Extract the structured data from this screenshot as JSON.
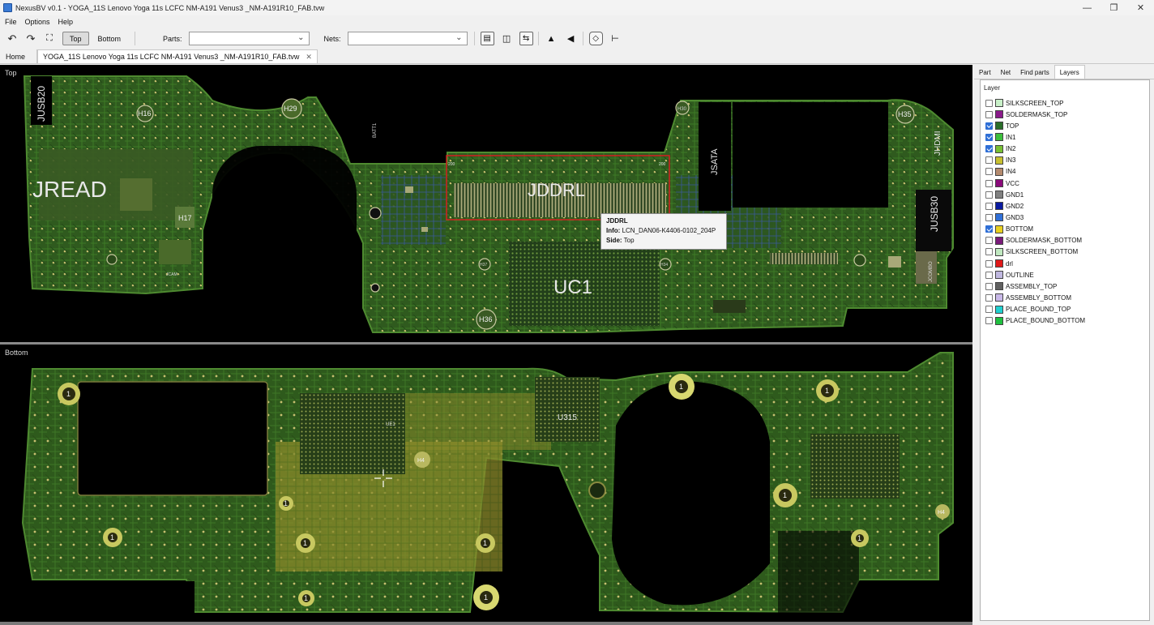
{
  "window": {
    "title": "NexusBV v0.1 - YOGA_11S Lenovo Yoga 11s LCFC NM-A191 Venus3 _NM-A191R10_FAB.tvw"
  },
  "menu": [
    "File",
    "Options",
    "Help"
  ],
  "toolbar": {
    "top_label": "Top",
    "bottom_label": "Bottom",
    "parts_label": "Parts:",
    "parts_value": "",
    "nets_label": "Nets:",
    "nets_value": ""
  },
  "tabs": [
    {
      "label": "Home"
    },
    {
      "label": "YOGA_11S Lenovo Yoga 11s LCFC NM-A191 Venus3 _NM-A191R10_FAB.tvw"
    }
  ],
  "views": {
    "top_label": "Top",
    "bottom_label": "Bottom"
  },
  "board_top_labels": {
    "jread": "JREAD",
    "jddrl": "JDDRL",
    "uc1": "UC1",
    "jusb20": "JUSB20",
    "jsata": "JSATA",
    "jhdmi": "JHDMI",
    "jusb30": "JUSB30",
    "h16": "H16",
    "h29": "H29",
    "h17": "H17",
    "h35": "H35",
    "h36": "H36",
    "h30": "H30",
    "h37": "H37",
    "h34": "H34",
    "batt1": "BATT1",
    "jcombo": "JCOMBO",
    "jcam": "JCAM",
    "ctr1": "200",
    "ctr2": "200"
  },
  "board_bottom_labels": {
    "u315": "U315",
    "ue1": "UE1",
    "h4a": "H4",
    "h4b": "H4",
    "one": "1"
  },
  "tooltip": {
    "title": "JDDRL",
    "info_label": "Info:",
    "info_value": "LCN_DAN06-K4406-0102_204P",
    "side_label": "Side:",
    "side_value": "Top"
  },
  "right_panel": {
    "tabs": [
      "Part",
      "Net",
      "Find parts",
      "Layers"
    ],
    "layer_header": "Layer",
    "layers": [
      {
        "name": "SILKSCREEN_TOP",
        "checked": false,
        "color": "#c8f0c8"
      },
      {
        "name": "SOLDERMASK_TOP",
        "checked": false,
        "color": "#8a1a8a"
      },
      {
        "name": "TOP",
        "checked": true,
        "color": "#2a6e2a"
      },
      {
        "name": "IN1",
        "checked": true,
        "color": "#3cbf3c"
      },
      {
        "name": "IN2",
        "checked": true,
        "color": "#78c034"
      },
      {
        "name": "IN3",
        "checked": false,
        "color": "#c8c030"
      },
      {
        "name": "IN4",
        "checked": false,
        "color": "#b48a6e"
      },
      {
        "name": "VCC",
        "checked": false,
        "color": "#8a0a7a"
      },
      {
        "name": "GND1",
        "checked": false,
        "color": "#808080"
      },
      {
        "name": "GND2",
        "checked": false,
        "color": "#0a1aa0"
      },
      {
        "name": "GND3",
        "checked": false,
        "color": "#3070d8"
      },
      {
        "name": "BOTTOM",
        "checked": true,
        "color": "#e8d020"
      },
      {
        "name": "SOLDERMASK_BOTTOM",
        "checked": false,
        "color": "#7a1a7a"
      },
      {
        "name": "SILKSCREEN_BOTTOM",
        "checked": false,
        "color": "#c0e8c0"
      },
      {
        "name": "drl",
        "checked": false,
        "color": "#e01818"
      },
      {
        "name": "OUTLINE",
        "checked": false,
        "color": "#c0b8e0"
      },
      {
        "name": "ASSEMBLY_TOP",
        "checked": false,
        "color": "#606060"
      },
      {
        "name": "ASSEMBLY_BOTTOM",
        "checked": false,
        "color": "#c8b8e8"
      },
      {
        "name": "PLACE_BOUND_TOP",
        "checked": false,
        "color": "#20d0d0"
      },
      {
        "name": "PLACE_BOUND_BOTTOM",
        "checked": false,
        "color": "#20c040"
      }
    ]
  }
}
